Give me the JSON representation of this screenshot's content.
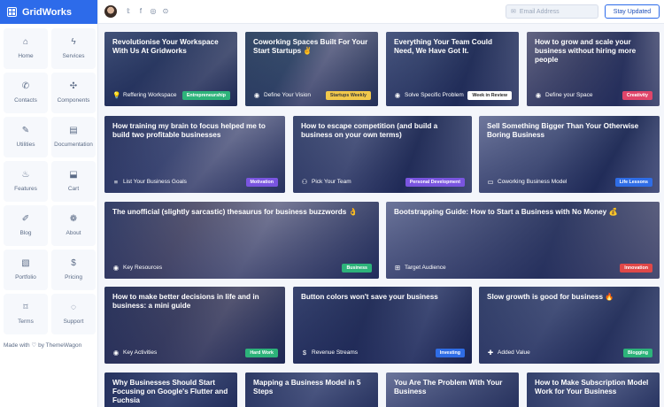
{
  "brand": {
    "name": "GridWorks"
  },
  "sidebar": {
    "items": [
      {
        "label": "Home",
        "icon": "⌂"
      },
      {
        "label": "Services",
        "icon": "ϟ"
      },
      {
        "label": "Contacts",
        "icon": "✆"
      },
      {
        "label": "Components",
        "icon": "✣"
      },
      {
        "label": "Utilities",
        "icon": "✎"
      },
      {
        "label": "Documentation",
        "icon": "▤"
      },
      {
        "label": "Features",
        "icon": "♨"
      },
      {
        "label": "Cart",
        "icon": "⬓"
      },
      {
        "label": "Blog",
        "icon": "✐"
      },
      {
        "label": "About",
        "icon": "❁"
      },
      {
        "label": "Portfolio",
        "icon": "▧"
      },
      {
        "label": "Pricing",
        "icon": "$"
      },
      {
        "label": "Terms",
        "icon": "⌑"
      },
      {
        "label": "Support",
        "icon": "◌"
      }
    ],
    "made_with_prefix": "Made with",
    "made_with_suffix": "by ThemeWagon"
  },
  "topbar": {
    "social": [
      "𝕥",
      "f",
      "◎",
      "⊙"
    ],
    "email_placeholder": "Email Address",
    "subscribe_label": "Stay Updated"
  },
  "colors": {
    "brand": "#2d6bea",
    "badge_green": "#2db37a",
    "badge_yellow": "#f1c84b",
    "badge_purple": "#7a55e0",
    "badge_pink": "#e0456a",
    "badge_blue": "#2f6de6",
    "badge_red": "#e04848"
  },
  "cards": [
    {
      "title": "Revolutionise Your Workspace With Us At Gridworks",
      "meta": "Reffering Workspace",
      "icon": "💡",
      "badge": "Entrepreneurship"
    },
    {
      "title": "Coworking Spaces Built For Your Start Startups ✌",
      "meta": "Define Your Vision",
      "icon": "◉",
      "badge": "Startups Weekly"
    },
    {
      "title": "Everything Your Team Could Need, We Have Got It.",
      "meta": "Solve Specific Problem",
      "icon": "◉",
      "badge": "Week in Review"
    },
    {
      "title": "How to grow and scale your business without hiring more people",
      "meta": "Define your Space",
      "icon": "◉",
      "badge": "Creativity"
    },
    {
      "title": "How training my brain to focus helped me to build two profitable businesses",
      "meta": "List Your Business Goals",
      "icon": "≡",
      "badge": "Motivation"
    },
    {
      "title": "How to escape competition (and build a business on your own terms)",
      "meta": "Pick Your Team",
      "icon": "⚇",
      "badge": "Personal Development"
    },
    {
      "title": "Sell Something Bigger Than Your Otherwise Boring Business",
      "meta": "Coworking Business Model",
      "icon": "▭",
      "badge": "Life Lessons"
    },
    {
      "title": "The unofficial (slightly sarcastic) thesaurus for business buzzwords 👌",
      "meta": "Key Resources",
      "icon": "◉",
      "badge": "Business"
    },
    {
      "title": "Bootstrapping Guide: How to Start a Business with No Money 💰",
      "meta": "Target Audience",
      "icon": "⊞",
      "badge": "Innovation"
    },
    {
      "title": "How to make better decisions in life and in business: a mini guide",
      "meta": "Key Activities",
      "icon": "◉",
      "badge": "Hard Work"
    },
    {
      "title": "Button colors won't save your business",
      "meta": "Revenue Streams",
      "icon": "$",
      "badge": "Investing"
    },
    {
      "title": "Slow growth is good for business 🔥",
      "meta": "Added Value",
      "icon": "✚",
      "badge": "Blogging"
    },
    {
      "title": "Why Businesses Should Start Focusing on Google's Flutter and Fuchsia",
      "meta": "",
      "icon": "",
      "badge": ""
    },
    {
      "title": "Mapping a Business Model in 5 Steps",
      "meta": "",
      "icon": "",
      "badge": ""
    },
    {
      "title": "You Are The Problem With Your Business",
      "meta": "",
      "icon": "",
      "badge": ""
    },
    {
      "title": "How to Make Subscription Model Work for Your Business",
      "meta": "",
      "icon": "",
      "badge": ""
    }
  ]
}
